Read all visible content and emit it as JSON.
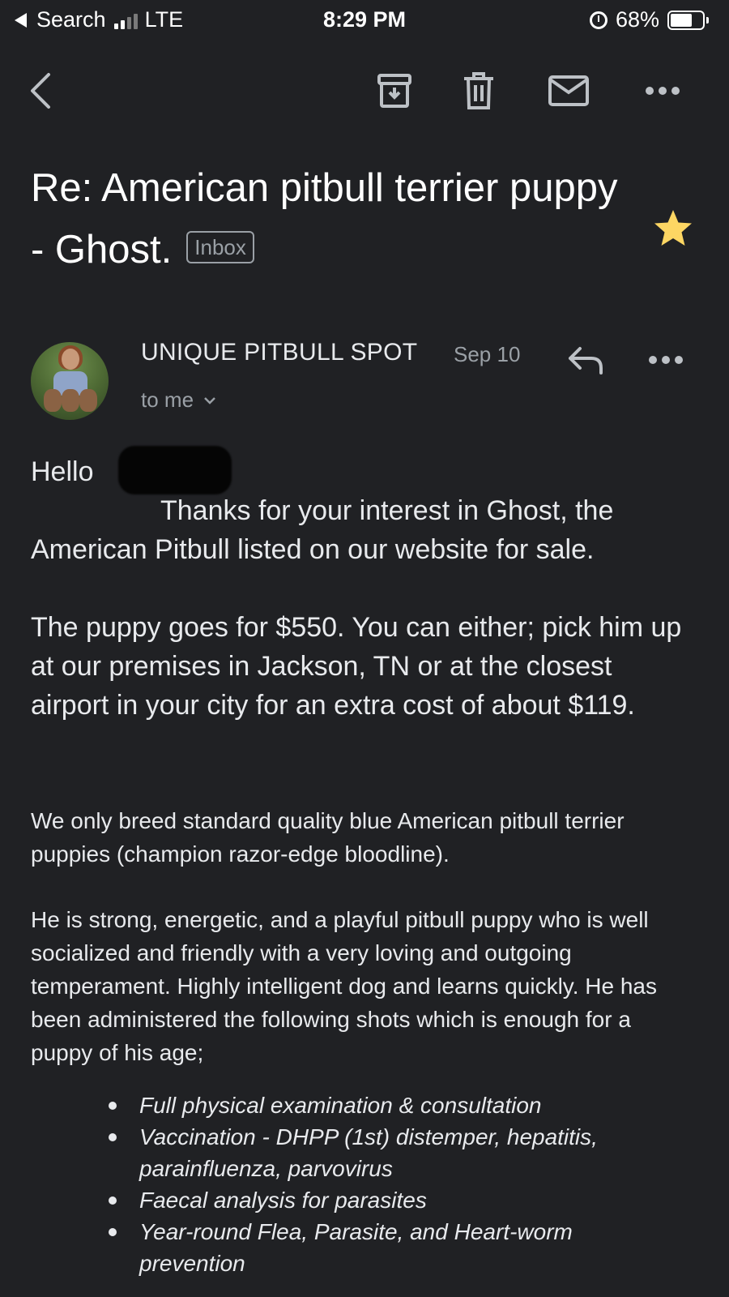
{
  "status_bar": {
    "back_app": "Search",
    "network": "LTE",
    "time": "8:29 PM",
    "battery": "68%",
    "battery_level": 0.68
  },
  "toolbar": {
    "icons": [
      "back-arrow-icon",
      "archive-icon",
      "delete-icon",
      "mark-unread-icon",
      "more-icon"
    ]
  },
  "email": {
    "subject": "Re: American pitbull terrier puppy - Ghost.",
    "label": "Inbox",
    "starred": true,
    "star_color": "#fdd663",
    "sender": "UNIQUE PITBULL SPOT",
    "date": "Sep 10",
    "recipient": "to me",
    "greeting": "Hello",
    "paragraphs_large": [
      "Thanks for your interest in Ghost, the American Pitbull listed on our website for sale.",
      "The puppy goes for $550. You can either; pick him up at our premises in Jackson, TN or at the closest airport in your city for an extra cost of about $119."
    ],
    "paragraphs_small": [
      "We only breed standard quality blue American pitbull terrier puppies (champion razor-edge bloodline).",
      "He is strong, energetic, and a playful pitbull puppy who is well socialized and friendly with a very loving and outgoing temperament. Highly intelligent dog and learns quickly. He has been administered the following shots which is enough for a puppy of his age;"
    ],
    "shots": [
      "Full physical examination & consultation",
      "Vaccination - DHPP (1st) distemper, hepatitis, parainfluenza, parvovirus",
      "Faecal analysis for parasites",
      "Year-round Flea, Parasite, and Heart-worm prevention"
    ]
  }
}
